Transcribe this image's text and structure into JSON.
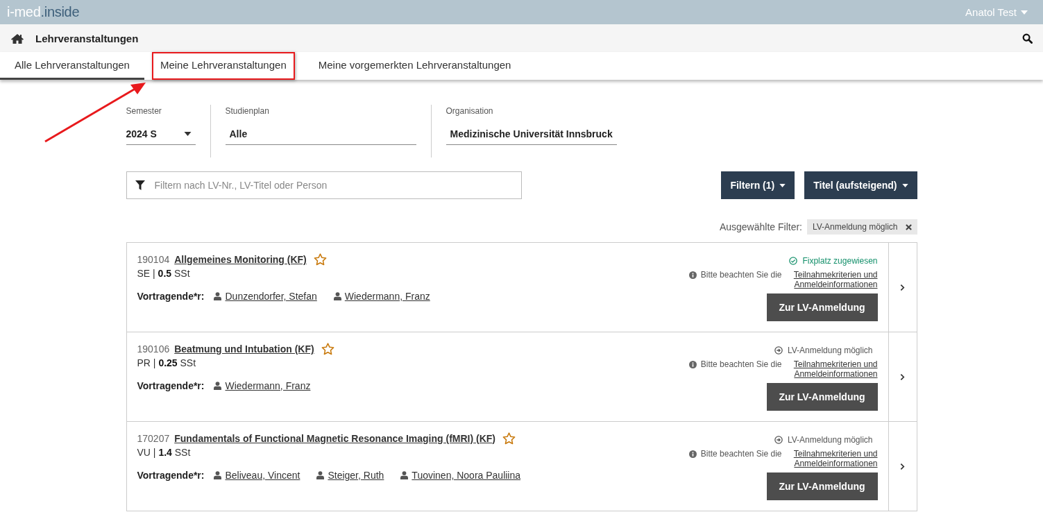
{
  "topbar": {
    "logo_part_1": "i-med",
    "logo_part_2": ".inside",
    "user": "Anatol Test"
  },
  "header": {
    "title": "Lehrveranstaltungen"
  },
  "tabs": [
    {
      "label": "Alle Lehrveranstaltungen",
      "selected": true,
      "highlighted": false
    },
    {
      "label": "Meine Lehrveranstaltungen",
      "selected": false,
      "highlighted": true
    },
    {
      "label": "Meine vorgemerkten Lehrveranstaltungen",
      "selected": false,
      "highlighted": false
    }
  ],
  "selects": [
    {
      "label": "Semester",
      "value": "2024 S",
      "kind": "dropdown"
    },
    {
      "label": "Studienplan",
      "value": "Alle",
      "kind": "text"
    },
    {
      "label": "Organisation",
      "value": "Medizinische Universität Innsbruck",
      "kind": "text"
    }
  ],
  "search": {
    "placeholder": "Filtern nach LV-Nr., LV-Titel oder Person"
  },
  "filter_button": "Filtern (1)",
  "sort_button": "Titel (aufsteigend)",
  "selected_filters": {
    "label": "Ausgewählte Filter:",
    "chips": [
      "LV-Anmeldung möglich"
    ]
  },
  "courses": [
    {
      "number": "190104",
      "title": "Allgemeines Monitoring (KF)",
      "favorite": false,
      "info": "SE | **0.5** SSt",
      "lecturer_label": "Vortragende*r:",
      "lecturers": [
        "Dunzendorfer, Stefan",
        "Wiedermann, Franz"
      ],
      "status": {
        "kind": "assigned",
        "text": "Fixplatz zugewiesen"
      },
      "note": "Bitte beachten Sie die",
      "note_link": "Teilnahmekriterien und Anmeldeinformationen",
      "button": "Zur LV-Anmeldung"
    },
    {
      "number": "190106",
      "title": "Beatmung und Intubation (KF)",
      "favorite": false,
      "info": "PR | **0.25** SSt",
      "lecturer_label": "Vortragende*r:",
      "lecturers": [
        "Wiedermann, Franz"
      ],
      "status": {
        "kind": "possible",
        "text": "LV-Anmeldung möglich"
      },
      "note": "Bitte beachten Sie die",
      "note_link": "Teilnahmekriterien und Anmeldeinformationen",
      "button": "Zur LV-Anmeldung"
    },
    {
      "number": "170207",
      "title": "Fundamentals of Functional Magnetic Resonance Imaging (fMRI) (KF)",
      "favorite": false,
      "info": "VU | **1.4** SSt",
      "lecturer_label": "Vortragende*r:",
      "lecturers": [
        "Beliveau, Vincent",
        "Steiger, Ruth",
        "Tuovinen, Noora Pauliina"
      ],
      "status": {
        "kind": "possible",
        "text": "LV-Anmeldung möglich"
      },
      "note": "Bitte beachten Sie die",
      "note_link": "Teilnahmekriterien und Anmeldeinformationen",
      "button": "Zur LV-Anmeldung"
    }
  ]
}
